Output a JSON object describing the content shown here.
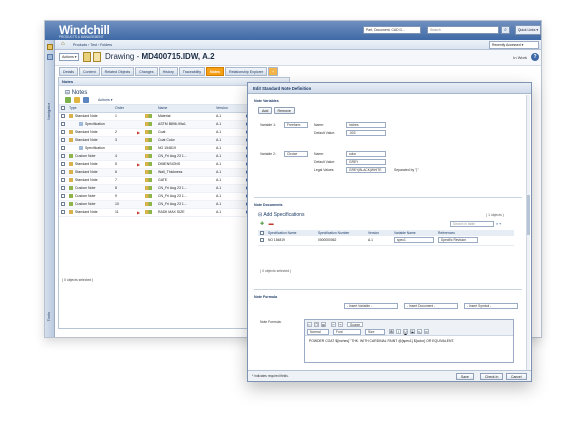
{
  "app": {
    "brand": "Windchill",
    "brand_sub": "PRODUCTS & MANAGEMENT",
    "search_scope": "Part, Document, CAD D...",
    "search_placeholder": "Search",
    "quick_links": "Quick Links ▾",
    "recent": "Recently Accessed ▾",
    "navigator_label": "Navigator",
    "rail_bottom": "Tools"
  },
  "breadcrumb": "Products › Test › Folders",
  "titlebar": {
    "actions": "Actions ▾",
    "object_type": "Drawing - ",
    "object_name": "MD400715.IDW, A.2",
    "status": "In Work"
  },
  "tabs": [
    {
      "label": "Details"
    },
    {
      "label": "Content"
    },
    {
      "label": "Related Objects"
    },
    {
      "label": "Changes"
    },
    {
      "label": "History"
    },
    {
      "label": "Traceability"
    },
    {
      "label": "Notes"
    },
    {
      "label": "Relationship Explorer"
    },
    {
      "label": "+"
    }
  ],
  "notes_panel": {
    "header": "Notes",
    "title": "Notes",
    "actions": "Actions ▾",
    "columns": [
      "",
      "Type",
      "Order",
      "",
      "",
      "Name",
      "Version",
      ""
    ],
    "rows": [
      {
        "type": "Standard Note",
        "order": "1",
        "flag": "",
        "name": "Material",
        "version": "A.1"
      },
      {
        "type": "Specification",
        "order": "",
        "flag": "",
        "name": "ASTM B896-99a1",
        "version": "A.1"
      },
      {
        "type": "Standard Note",
        "order": "2",
        "flag": "▶",
        "name": "Coat",
        "version": "A.1"
      },
      {
        "type": "Standard Note",
        "order": "3",
        "flag": "",
        "name": "Coat Color",
        "version": "A.1"
      },
      {
        "type": "Specification",
        "order": "",
        "flag": "",
        "name": "NO 154819",
        "version": "A.1"
      },
      {
        "type": "Custom Note",
        "order": "4",
        "flag": "",
        "name": "CN_Fri Aug 23 1...",
        "version": "A.1"
      },
      {
        "type": "Standard Note",
        "order": "5",
        "flag": "▶",
        "name": "DIMENSIONS",
        "version": "A.1"
      },
      {
        "type": "Standard Note",
        "order": "6",
        "flag": "",
        "name": "Wall_Thickness",
        "version": "A.1"
      },
      {
        "type": "Standard Note",
        "order": "7",
        "flag": "",
        "name": "GATE",
        "version": "A.1"
      },
      {
        "type": "Custom Note",
        "order": "8",
        "flag": "",
        "name": "CN_Fri Aug 23 1...",
        "version": "A.1"
      },
      {
        "type": "Custom Note",
        "order": "9",
        "flag": "",
        "name": "CN_Fri Aug 23 1...",
        "version": "A.1"
      },
      {
        "type": "Custom Note",
        "order": "10",
        "flag": "",
        "name": "CN_Fri Aug 23 1...",
        "version": "A.1"
      },
      {
        "type": "Standard Note",
        "order": "11",
        "flag": "▶",
        "name": "RADII MAX SIZE",
        "version": "A.1"
      }
    ],
    "selected": "( 0 objects selected )"
  },
  "dialog": {
    "title": "Edit Standard Note Definition",
    "note_variables": {
      "label": "Note Variables",
      "add": "Add",
      "remove": "Remove",
      "var1": {
        "label": "Variable 1:",
        "type": "Freeform",
        "name_label": "Name:",
        "name": "inches",
        "default_label": "Default Value:",
        "default": ".003"
      },
      "var2": {
        "label": "Variable 2:",
        "type": "Choice",
        "name_label": "Name:",
        "name": "color",
        "default_label": "Default Value:",
        "default": "GREY",
        "legal_label": "Legal Values:",
        "legal": "GREY|BLACK|WHITE",
        "separator": "Separated by \"|\""
      }
    },
    "note_documents": {
      "label": "Note Documents",
      "add_specs": "Add Specifications",
      "count": "( 1 objects )",
      "search_placeholder": "Search in table",
      "columns": [
        "",
        "Specification Name",
        "Specification Number",
        "Version",
        "Variable Name",
        "References"
      ],
      "rows": [
        {
          "name": "NO 154819",
          "number": "0000000062",
          "version": "A.1",
          "variable": "spec1",
          "reference": "Specific Revision"
        }
      ],
      "selected": "( 0 objects selected )"
    },
    "note_formula": {
      "label": "Note Formula",
      "insert_variable": "- Insert Variable -",
      "insert_document": "- Insert Document -",
      "insert_symbol": "- Insert Symbol -",
      "formula_label": "Note Formula:",
      "format": "Normal",
      "font": "Font",
      "size": "Size",
      "source": "Source",
      "text": "POWDER COAT ${inches}\" THK. WITH CARDINAL PAINT @{spec1} ${color} OR EQUIVALENT."
    },
    "footer": {
      "required": "* Indicates required fields.",
      "save": "Save",
      "check_in": "Check In",
      "cancel": "Cancel"
    }
  }
}
